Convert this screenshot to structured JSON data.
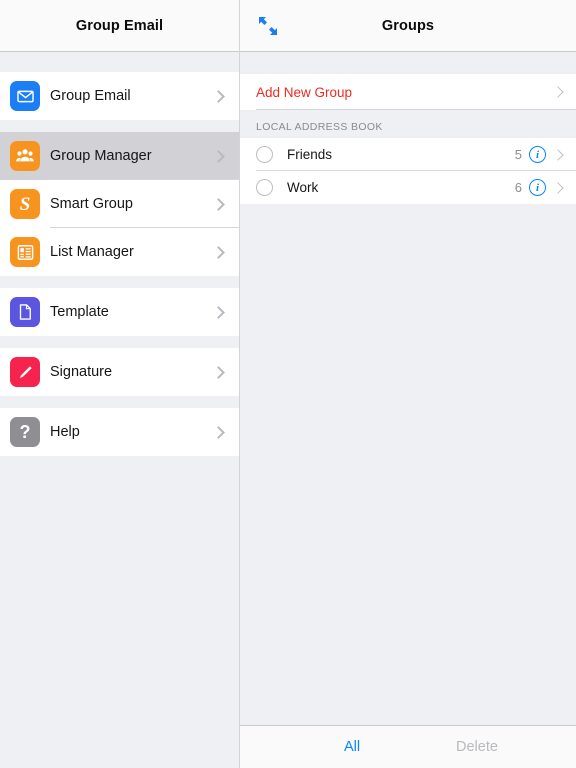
{
  "sidebar": {
    "title": "Group Email",
    "groups": [
      {
        "items": [
          {
            "label": "Group Email",
            "icon": "mail-icon",
            "color": "#1b7ef5",
            "selected": false
          }
        ]
      },
      {
        "items": [
          {
            "label": "Group Manager",
            "icon": "people-icon",
            "color": "#f79420",
            "selected": true
          },
          {
            "label": "Smart Group",
            "icon": "smart-s-icon",
            "color": "#f79420",
            "selected": false
          },
          {
            "label": "List Manager",
            "icon": "list-icon",
            "color": "#f79420",
            "selected": false
          }
        ]
      },
      {
        "items": [
          {
            "label": "Template",
            "icon": "document-icon",
            "color": "#5a56e0",
            "selected": false
          }
        ]
      },
      {
        "items": [
          {
            "label": "Signature",
            "icon": "pen-icon",
            "color": "#f6234f",
            "selected": false
          }
        ]
      },
      {
        "items": [
          {
            "label": "Help",
            "icon": "question-mark-icon",
            "color": "#8e8e93",
            "selected": false
          }
        ]
      }
    ]
  },
  "detail": {
    "title": "Groups",
    "expand_icon": "collapse-arrows-icon",
    "add_new_group": "Add New Group",
    "section_header": "LOCAL ADDRESS BOOK",
    "groups": [
      {
        "name": "Friends",
        "count": "5",
        "checked": false,
        "info_icon": "info-icon"
      },
      {
        "name": "Work",
        "count": "6",
        "checked": false,
        "info_icon": "info-icon"
      }
    ]
  },
  "toolbar": {
    "all_label": "All",
    "delete_label": "Delete",
    "all_color": "#0a84ff",
    "delete_color": "#b9b9be"
  }
}
